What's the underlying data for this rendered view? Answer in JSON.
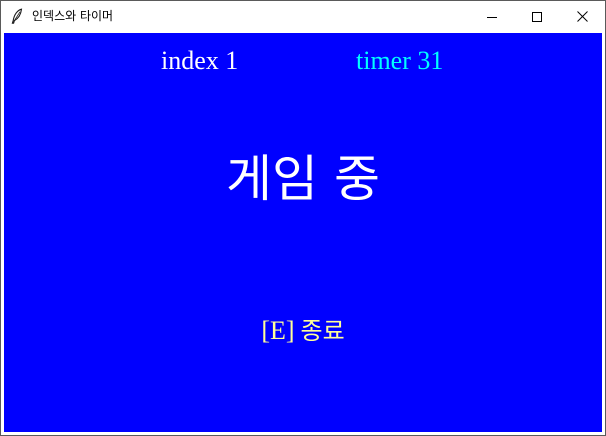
{
  "window": {
    "title": "인덱스와 타이머",
    "icon": "feather-icon",
    "controls": [
      "minimize-icon",
      "maximize-icon",
      "close-icon"
    ]
  },
  "canvas": {
    "background_color": "#0000ff",
    "index_label": "index 1",
    "index_color": "#ffffff",
    "timer_label": "timer 31",
    "timer_color": "#00ffff",
    "status_text": "게임 중",
    "status_color": "#ffffff",
    "exit_key": "[E]",
    "exit_text": "종료",
    "exit_color": "#ffff99"
  }
}
